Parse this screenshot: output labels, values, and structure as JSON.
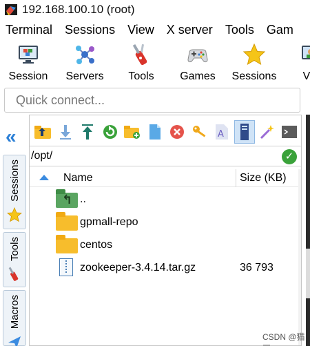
{
  "window": {
    "title": "192.168.100.10 (root)"
  },
  "menu": [
    "Terminal",
    "Sessions",
    "View",
    "X server",
    "Tools",
    "Gam"
  ],
  "toolbar": [
    {
      "label": "Session",
      "icon": "monitor-icon"
    },
    {
      "label": "Servers",
      "icon": "network-icon"
    },
    {
      "label": "Tools",
      "icon": "knife-icon"
    },
    {
      "label": "Games",
      "icon": "gamepad-icon"
    },
    {
      "label": "Sessions",
      "icon": "star-icon"
    },
    {
      "label": "Vie",
      "icon": "view-icon"
    }
  ],
  "quick_connect": {
    "placeholder": "Quick connect..."
  },
  "side_tabs": [
    {
      "label": "Sessions",
      "icon": "star-icon"
    },
    {
      "label": "Tools",
      "icon": "knife-icon"
    },
    {
      "label": "Macros",
      "icon": "paper-plane-icon"
    }
  ],
  "sftp": {
    "path": "/opt/",
    "columns": {
      "name": "Name",
      "size": "Size (KB)"
    },
    "files": [
      {
        "name": "..",
        "size": "",
        "type": "parent"
      },
      {
        "name": "gpmall-repo",
        "size": "",
        "type": "folder"
      },
      {
        "name": "centos",
        "size": "",
        "type": "folder"
      },
      {
        "name": "zookeeper-3.4.14.tar.gz",
        "size": "36 793",
        "type": "archive"
      }
    ]
  },
  "watermark": "CSDN @猫豆~",
  "colors": {
    "accent": "#2b7fd6",
    "folder": "#f7bd2c",
    "ok": "#3aa23a"
  }
}
